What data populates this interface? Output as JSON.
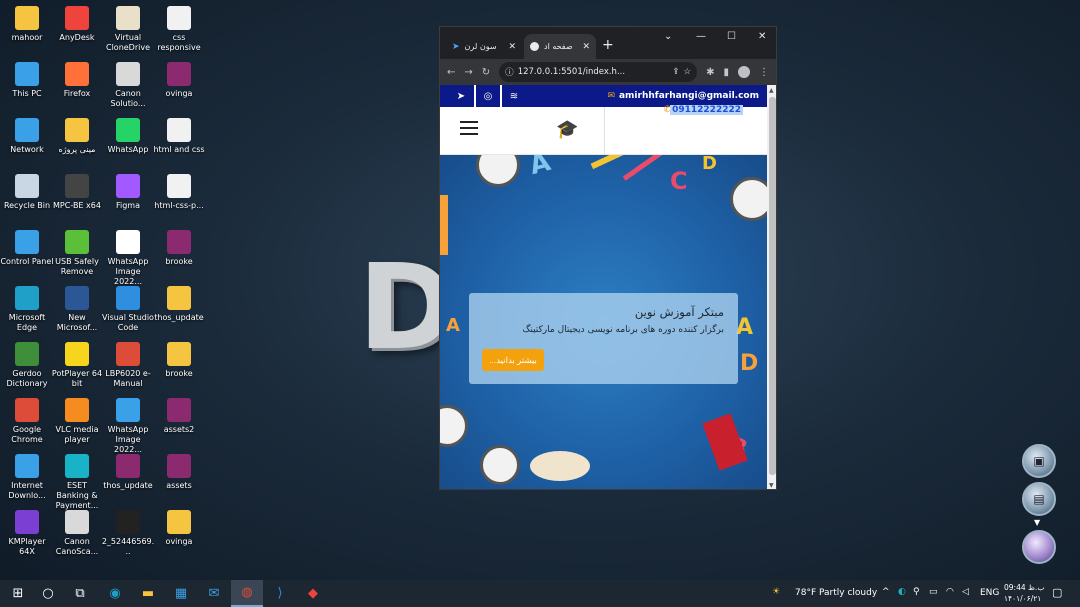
{
  "desktop": {
    "icons": [
      {
        "label": "mahoor",
        "icon": "folder-icon",
        "color": "#f5c542"
      },
      {
        "label": "AnyDesk",
        "icon": "anydesk-icon",
        "color": "#ef443b"
      },
      {
        "label": "Virtual CloneDrive",
        "icon": "sheep-icon",
        "color": "#e8e0c8"
      },
      {
        "label": "css responsive",
        "icon": "chrome-doc-icon",
        "color": "#f1f1f1"
      },
      {
        "label": "This PC",
        "icon": "computer-icon",
        "color": "#3aa0e8"
      },
      {
        "label": "Firefox",
        "icon": "firefox-icon",
        "color": "#ff7139"
      },
      {
        "label": "Canon Solutio...",
        "icon": "canon-icon",
        "color": "#d9d9d9"
      },
      {
        "label": "ovinga",
        "icon": "winrar-icon",
        "color": "#8b2a6e"
      },
      {
        "label": "Network",
        "icon": "network-icon",
        "color": "#3aa0e8"
      },
      {
        "label": "مینی پروژه",
        "icon": "folder-doc-icon",
        "color": "#f5c542"
      },
      {
        "label": "WhatsApp",
        "icon": "whatsapp-icon",
        "color": "#25d366"
      },
      {
        "label": "html and css",
        "icon": "pdf-icon",
        "color": "#f1f1f1"
      },
      {
        "label": "Recycle Bin",
        "icon": "recycle-bin-icon",
        "color": "#c9d6e3"
      },
      {
        "label": "MPC-BE x64",
        "icon": "clapper-icon",
        "color": "#444444"
      },
      {
        "label": "Figma",
        "icon": "figma-icon",
        "color": "#a259ff"
      },
      {
        "label": "html-css-p...",
        "icon": "chrome-doc-icon",
        "color": "#f1f1f1"
      },
      {
        "label": "Control Panel",
        "icon": "control-panel-icon",
        "color": "#3aa0e8"
      },
      {
        "label": "USB Safely Remove",
        "icon": "usb-icon",
        "color": "#5bbf3a"
      },
      {
        "label": "WhatsApp Image 2022...",
        "icon": "image-icon",
        "color": "#ffffff"
      },
      {
        "label": "brooke",
        "icon": "winrar-icon",
        "color": "#8b2a6e"
      },
      {
        "label": "Microsoft Edge",
        "icon": "edge-icon",
        "color": "#1fa0c9"
      },
      {
        "label": "New Microsof...",
        "icon": "word-icon",
        "color": "#2b5797"
      },
      {
        "label": "Visual Studio Code",
        "icon": "vscode-icon",
        "color": "#2e8ee0"
      },
      {
        "label": "thos_update",
        "icon": "folder-icon",
        "color": "#f5c542"
      },
      {
        "label": "Gerdoo Dictionary",
        "icon": "gerdoo-icon",
        "color": "#3f8f3a"
      },
      {
        "label": "PotPlayer 64 bit",
        "icon": "potplayer-icon",
        "color": "#f7d51c"
      },
      {
        "label": "LBP6020 e-Manual",
        "icon": "chrome-icon",
        "color": "#dd4b39"
      },
      {
        "label": "brooke",
        "icon": "folder-icon",
        "color": "#f5c542"
      },
      {
        "label": "Google Chrome",
        "icon": "chrome-icon",
        "color": "#dd4b39"
      },
      {
        "label": "VLC media player",
        "icon": "vlc-icon",
        "color": "#f68b1f"
      },
      {
        "label": "WhatsApp Image 2022...",
        "icon": "image-icon",
        "color": "#3aa0e8"
      },
      {
        "label": "assets2",
        "icon": "winrar-icon",
        "color": "#8b2a6e"
      },
      {
        "label": "Internet Downlo...",
        "icon": "idm-icon",
        "color": "#3aa0e8"
      },
      {
        "label": "ESET Banking & Payment...",
        "icon": "eset-icon",
        "color": "#19b3c8"
      },
      {
        "label": "thos_update",
        "icon": "winrar-icon",
        "color": "#8b2a6e"
      },
      {
        "label": "assets",
        "icon": "winrar-icon",
        "color": "#8b2a6e"
      },
      {
        "label": "KMPlayer 64X",
        "icon": "kmplayer-icon",
        "color": "#7b3fd4"
      },
      {
        "label": "Canon CanoSca...",
        "icon": "canon-scan-icon",
        "color": "#d9d9d9"
      },
      {
        "label": "2_52446569...",
        "icon": "video-file-icon",
        "color": "#222222"
      },
      {
        "label": "ovinga",
        "icon": "folder-icon",
        "color": "#f5c542"
      }
    ]
  },
  "browser": {
    "tabs": [
      {
        "label": "سون لرن",
        "icon": "site-logo-icon"
      },
      {
        "label": "صفحه اد",
        "icon": "globe-icon"
      }
    ],
    "url": "127.0.0.1:5501/index.h..."
  },
  "site": {
    "email": "amirhhfarhangi@gmail.com",
    "phone": "09112222222",
    "social": [
      "telegram-icon",
      "instagram-icon",
      "rss-icon"
    ],
    "hero": {
      "title": "مبتکر آموزش نوین",
      "subtitle": "برگزار کننده دوره های برنامه نویسی دیجیتال مارکتینگ",
      "button": "بیشتر بدانید..."
    }
  },
  "taskbar": {
    "weather": "78°F  Partly cloudy",
    "language": "ENG",
    "time": "09:44 ب.ظ",
    "date": "۱۴۰۱/۰۶/۲۱"
  },
  "colors": {
    "topstrip": "#0b1a88",
    "accent_button": "#f3a10c",
    "phone_link": "#1a4fd6"
  }
}
